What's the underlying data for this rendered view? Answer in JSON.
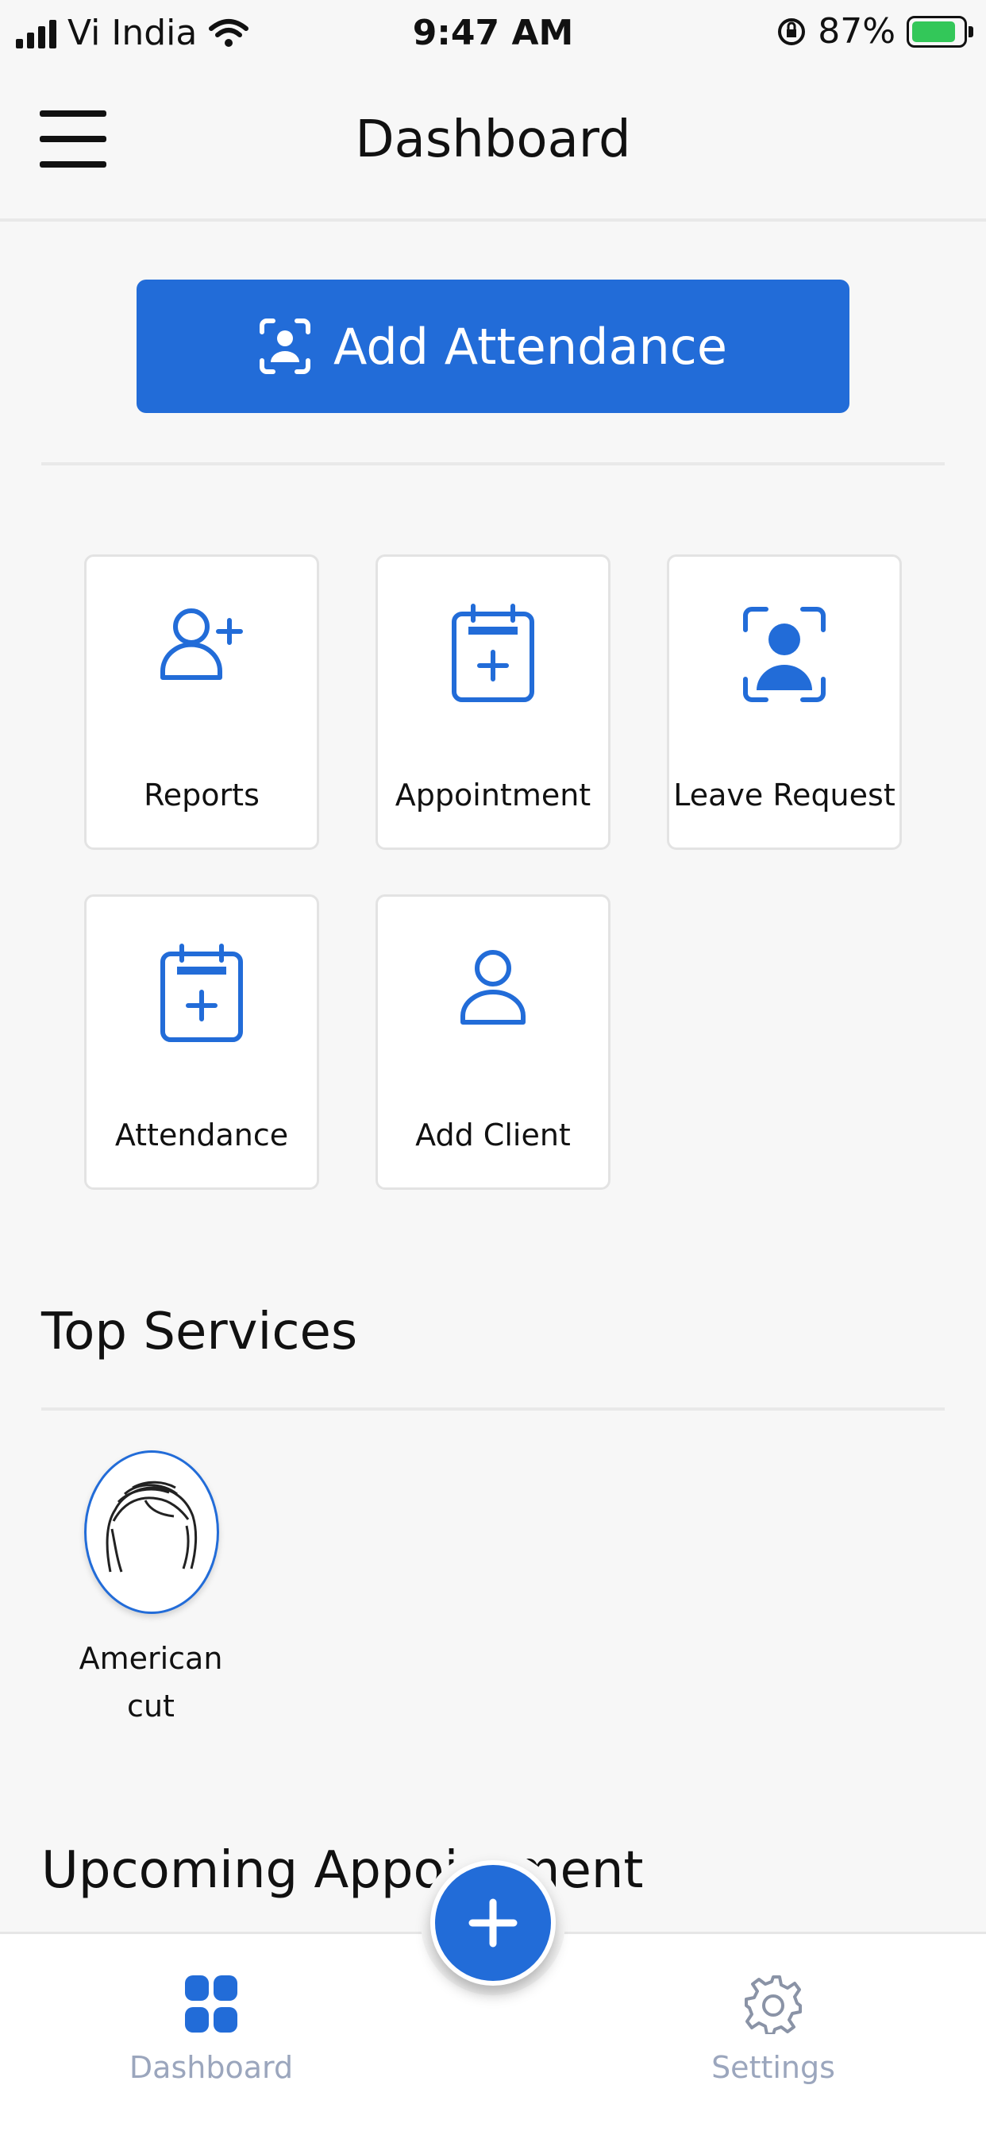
{
  "status_bar": {
    "carrier": "Vi India",
    "time": "9:47 AM",
    "battery": "87%",
    "battery_level": 0.87
  },
  "header": {
    "title": "Dashboard",
    "menu_icon": "hamburger-menu-icon"
  },
  "add_attendance": {
    "label": "Add Attendance",
    "icon": "face-scan-icon",
    "color": "#226cd8"
  },
  "tiles": [
    {
      "label": "Reports",
      "icon": "person-add-icon"
    },
    {
      "label": "Appointment",
      "icon": "calendar-add-icon"
    },
    {
      "label": "Leave Request",
      "icon": "face-scan-icon"
    },
    {
      "label": "Attendance",
      "icon": "calendar-add-icon"
    },
    {
      "label": "Add Client",
      "icon": "person-icon"
    }
  ],
  "top_services": {
    "title": "Top Services",
    "items": [
      {
        "label_line1": "American",
        "label_line2": "cut",
        "icon": "hair-icon"
      }
    ]
  },
  "upcoming": {
    "title": "Upcoming Appointment"
  },
  "bottom_nav": {
    "items": [
      {
        "label": "Dashboard",
        "icon": "grid-icon",
        "active": true
      },
      {
        "label": "Settings",
        "icon": "gear-icon",
        "active": false
      }
    ],
    "fab_icon": "plus-icon"
  },
  "colors": {
    "accent": "#226cd8",
    "background": "#f7f7f7",
    "inactive": "#9ba6bd"
  }
}
